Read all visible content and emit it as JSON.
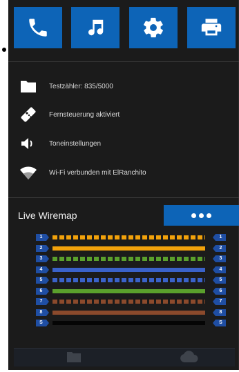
{
  "toolbar": {
    "buttons": [
      {
        "name": "phone-icon",
        "color": "#0d64b7"
      },
      {
        "name": "music-note-icon",
        "color": "#0d64b7"
      },
      {
        "name": "gear-icon",
        "color": "#0d64b7"
      },
      {
        "name": "printer-icon",
        "color": "#0d64b7"
      }
    ]
  },
  "status": {
    "items": [
      {
        "icon": "folder-icon",
        "label": "Testzähler: 835/5000"
      },
      {
        "icon": "remote-control-icon",
        "label": "Fernsteuerung aktiviert"
      },
      {
        "icon": "speaker-icon",
        "label": "Toneinstellungen"
      },
      {
        "icon": "wifi-icon",
        "label": "Wi-Fi verbunden mit ElRanchito"
      }
    ]
  },
  "wiremap": {
    "title": "Live Wiremap",
    "more_button": "more-dots-icon",
    "wires": [
      {
        "left": "1",
        "right": "1",
        "color": "#f2a20b",
        "style": "dashed"
      },
      {
        "left": "2",
        "right": "2",
        "color": "#f2a20b",
        "style": "solid"
      },
      {
        "left": "3",
        "right": "3",
        "color": "#5aa02c",
        "style": "dashed"
      },
      {
        "left": "4",
        "right": "4",
        "color": "#3a62c9",
        "style": "solid"
      },
      {
        "left": "5",
        "right": "5",
        "color": "#3a62c9",
        "style": "dashed"
      },
      {
        "left": "6",
        "right": "6",
        "color": "#5aa02c",
        "style": "solid"
      },
      {
        "left": "7",
        "right": "7",
        "color": "#8b4a2c",
        "style": "dashed"
      },
      {
        "left": "8",
        "right": "8",
        "color": "#8b4a2c",
        "style": "solid"
      },
      {
        "left": "S",
        "right": "S",
        "color": "#050505",
        "style": "solid"
      }
    ]
  },
  "bottom_nav": {
    "items": [
      {
        "icon": "folder-icon"
      },
      {
        "icon": "cloud-icon"
      }
    ]
  }
}
